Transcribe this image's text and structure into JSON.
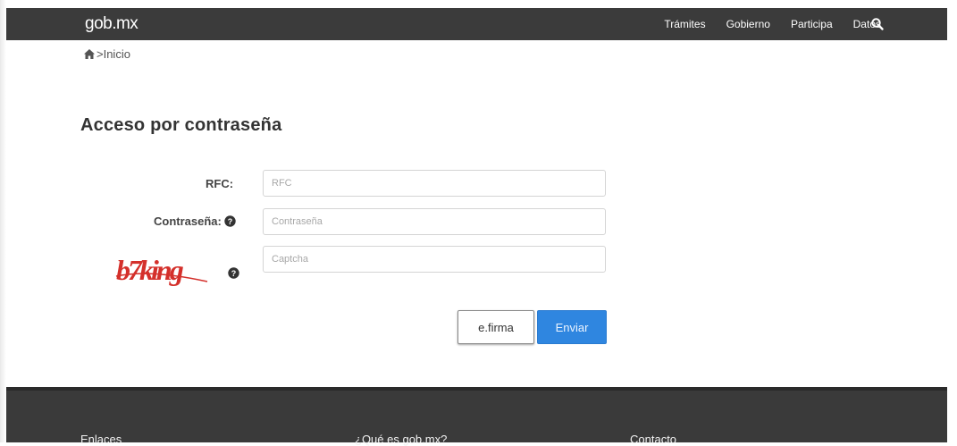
{
  "header": {
    "brand": "gob.mx",
    "nav": [
      "Trámites",
      "Gobierno",
      "Participa",
      "Datos"
    ],
    "search_icon": "search-icon"
  },
  "breadcrumb": {
    "icon": "home-icon",
    "separator": ">",
    "current": "Inicio"
  },
  "page": {
    "title": "Acceso por contraseña"
  },
  "form": {
    "rfc_label": "RFC:",
    "rfc_placeholder": "RFC",
    "password_label": "Contraseña:",
    "password_placeholder": "Contraseña",
    "captcha_text": "b7king",
    "captcha_placeholder": "Captcha",
    "efirma_label": "e.firma",
    "submit_label": "Enviar"
  },
  "footer": {
    "headings": [
      "Enlaces",
      "¿Qué es gob.mx?",
      "Contacto"
    ]
  },
  "colors": {
    "header_bg": "#3b3b3b",
    "footer_bg": "#3a3a3a",
    "primary_button": "#2f86e0",
    "captcha_red": "#d4302b"
  }
}
